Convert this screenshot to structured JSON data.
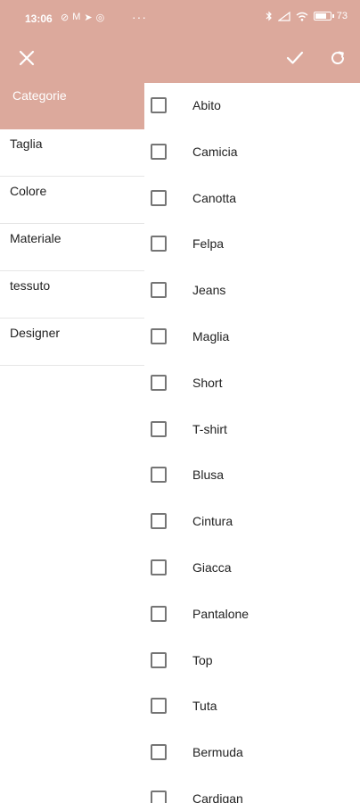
{
  "status_bar": {
    "time": "13:06",
    "left_icons": [
      "⊘",
      "M",
      "➤",
      "◎"
    ],
    "more": "···",
    "battery": "73",
    "battery_level": 0.73
  },
  "toolbar": {
    "close_icon": "close-icon",
    "confirm_icon": "check-icon",
    "refresh_icon": "refresh-icon"
  },
  "sidebar": {
    "items": [
      {
        "label": "Categorie",
        "active": true
      },
      {
        "label": "Taglia",
        "active": false
      },
      {
        "label": "Colore",
        "active": false
      },
      {
        "label": "Materiale",
        "active": false
      },
      {
        "label": "tessuto",
        "active": false
      },
      {
        "label": "Designer",
        "active": false
      }
    ]
  },
  "options": {
    "items": [
      {
        "label": "Abito",
        "checked": false
      },
      {
        "label": "Camicia",
        "checked": false
      },
      {
        "label": "Canotta",
        "checked": false
      },
      {
        "label": "Felpa",
        "checked": false
      },
      {
        "label": "Jeans",
        "checked": false
      },
      {
        "label": "Maglia",
        "checked": false
      },
      {
        "label": "Short",
        "checked": false
      },
      {
        "label": "T-shirt",
        "checked": false
      },
      {
        "label": "Blusa",
        "checked": false
      },
      {
        "label": "Cintura",
        "checked": false
      },
      {
        "label": "Giacca",
        "checked": false
      },
      {
        "label": "Pantalone",
        "checked": false
      },
      {
        "label": "Top",
        "checked": false
      },
      {
        "label": "Tuta",
        "checked": false
      },
      {
        "label": "Bermuda",
        "checked": false
      },
      {
        "label": "Cardigan",
        "checked": false
      }
    ]
  },
  "colors": {
    "accent": "#dca99c",
    "checkbox_border": "#757575",
    "divider": "#e6e6e6"
  }
}
